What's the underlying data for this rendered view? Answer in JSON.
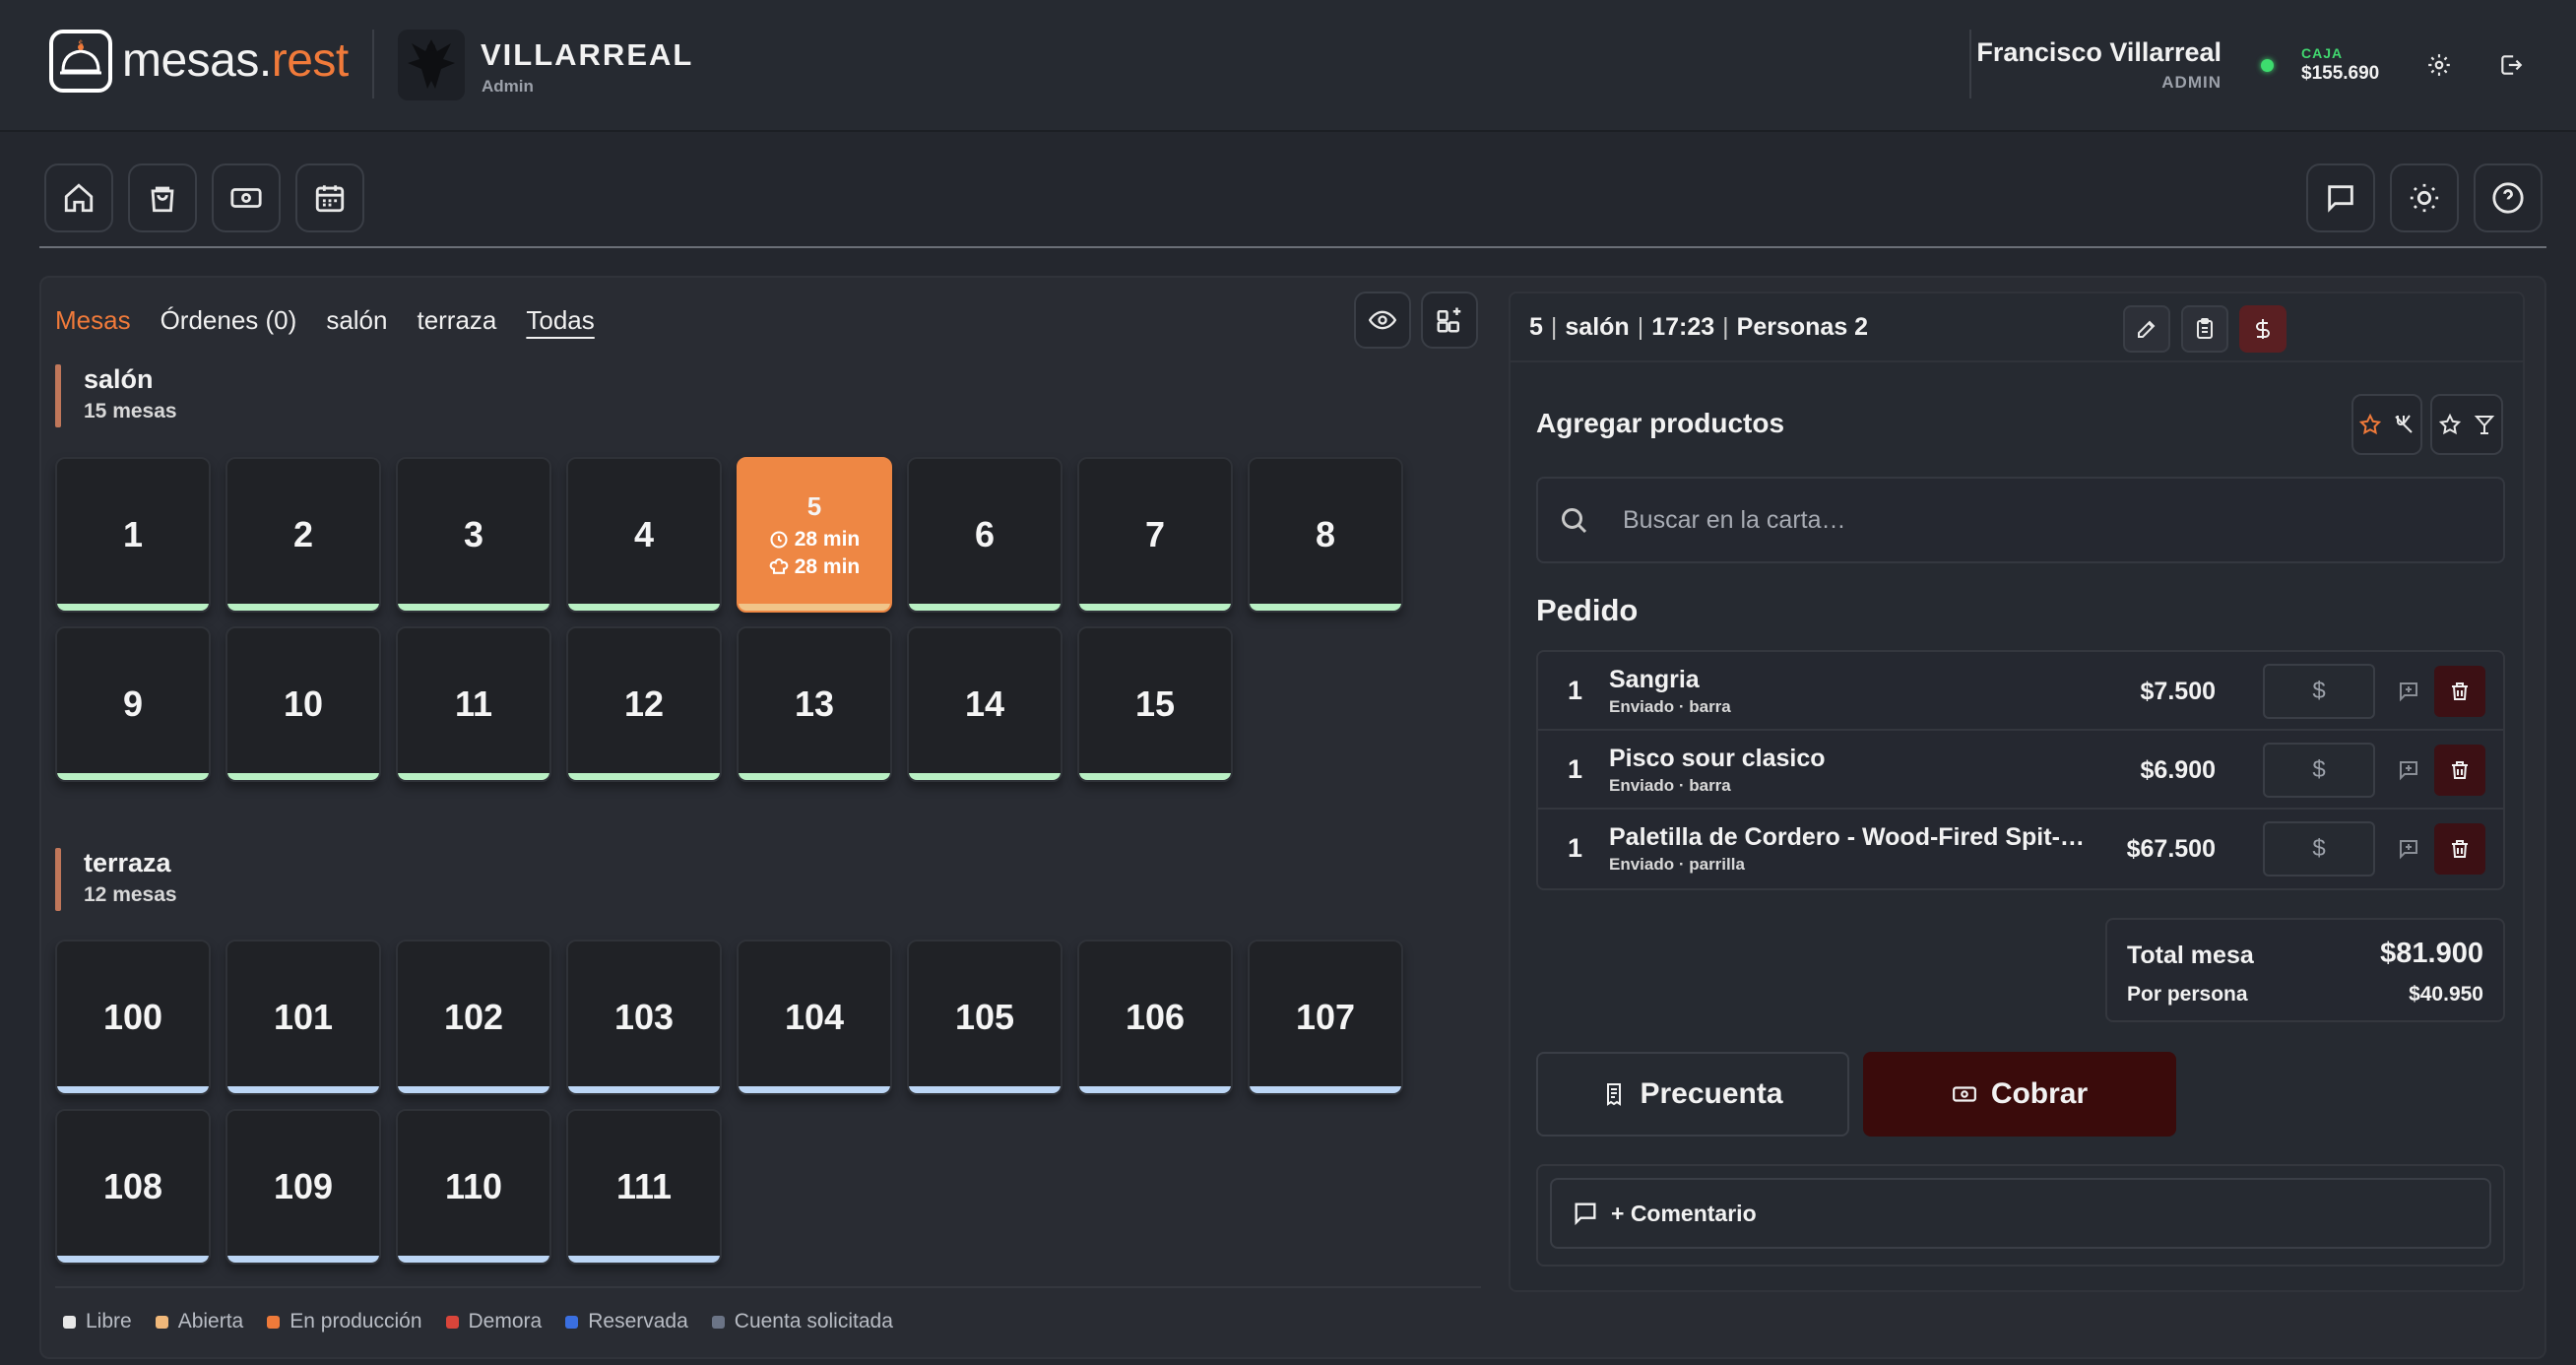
{
  "brand": {
    "word": "mesas.",
    "accent": "rest"
  },
  "restaurant": {
    "name": "VILLARREAL",
    "role": "Admin"
  },
  "user": {
    "name": "Francisco Villarreal",
    "role": "ADMIN"
  },
  "caja": {
    "label": "CAJA",
    "amount": "$155.690",
    "status_color": "#3ddc6e"
  },
  "header_icons": [
    "gear-icon",
    "logout-icon"
  ],
  "toolbar": {
    "left": [
      "home-icon",
      "shopping-bag-icon",
      "cash-icon",
      "calendar-icon"
    ],
    "right": [
      "chat-icon",
      "sun-icon",
      "help-icon"
    ]
  },
  "tabs": [
    {
      "label": "Mesas",
      "state": "active"
    },
    {
      "label": "Órdenes (0)",
      "state": "normal"
    },
    {
      "label": "salón",
      "state": "normal"
    },
    {
      "label": "terraza",
      "state": "normal"
    },
    {
      "label": "Todas",
      "state": "selected"
    }
  ],
  "sections": [
    {
      "title": "salón",
      "count": "15 mesas",
      "tables": [
        "1",
        "2",
        "3",
        "4",
        "5",
        "6",
        "7",
        "8",
        "9",
        "10",
        "11",
        "12",
        "13",
        "14",
        "15"
      ]
    },
    {
      "title": "terraza",
      "count": "12 mesas",
      "tables": [
        "100",
        "101",
        "102",
        "103",
        "104",
        "105",
        "106",
        "107",
        "108",
        "109",
        "110",
        "111"
      ]
    }
  ],
  "active_table": {
    "number": "5",
    "time_open": "28 min",
    "time_cooking": "28 min"
  },
  "legend": [
    {
      "label": "Libre",
      "color": "#e8e8e8"
    },
    {
      "label": "Abierta",
      "color": "#f0b87a"
    },
    {
      "label": "En producción",
      "color": "#ee7a3a"
    },
    {
      "label": "Demora",
      "color": "#d9453a"
    },
    {
      "label": "Reservada",
      "color": "#3a6fe0"
    },
    {
      "label": "Cuenta solicitada",
      "color": "#6b7486"
    }
  ],
  "order": {
    "table": "5",
    "zone": "salón",
    "time": "17:23",
    "people": "Personas 2",
    "add_title": "Agregar productos",
    "search_placeholder": "Buscar en la carta…",
    "pedido_title": "Pedido",
    "currency_symbol": "$",
    "items": [
      {
        "qty": "1",
        "name": "Sangria",
        "status": "Enviado · barra",
        "price": "$7.500"
      },
      {
        "qty": "1",
        "name": "Pisco sour clasico",
        "status": "Enviado · barra",
        "price": "$6.900"
      },
      {
        "qty": "1",
        "name": "Paletilla de Cordero - Wood-Fired Spit-Roasted Lamb",
        "status": "Enviado · parrilla",
        "price": "$67.500"
      }
    ],
    "total_label": "Total mesa",
    "total_value": "$81.900",
    "per_person_label": "Por persona",
    "per_person_value": "$40.950",
    "precuenta_label": "Precuenta",
    "cobrar_label": "Cobrar",
    "comment_label": "+ Comentario"
  }
}
